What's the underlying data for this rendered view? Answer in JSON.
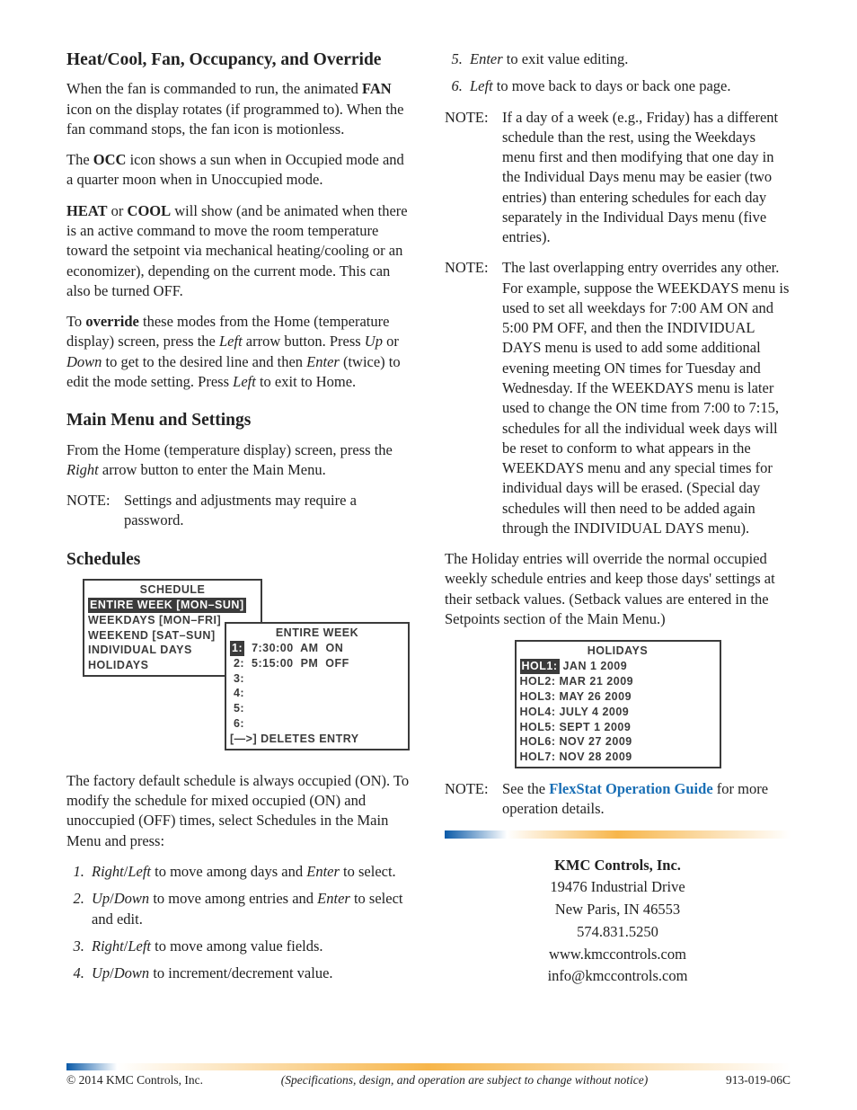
{
  "left": {
    "h_heatcool": "Heat/Cool, Fan, Occupancy, and Override",
    "p1a": "When the fan is commanded to run, the animated ",
    "p1b": "FAN",
    "p1c": " icon on the display rotates (if programmed to). When the fan command stops, the fan icon is motionless.",
    "p2a": "The ",
    "p2b": "OCC",
    "p2c": " icon shows a sun when in Occupied mode and a quarter moon when in Unoccupied mode.",
    "p3a": "HEAT",
    "p3b": " or ",
    "p3c": "COOL",
    "p3d": " will show (and be animated when there is an active command to move the room temperature toward the setpoint via mechanical heating/cooling or an economizer), depending on the current mode. This can also be turned OFF.",
    "p4a": "To ",
    "p4b": "override",
    "p4c": " these modes from the Home (temperature display) screen, press the ",
    "p4d": "Left",
    "p4e": " arrow button. Press ",
    "p4f": "Up",
    "p4g": " or ",
    "p4h": "Down",
    "p4i": " to get to the desired line and then ",
    "p4j": "Enter",
    "p4k": " (twice) to edit the mode setting. Press ",
    "p4l": "Left",
    "p4m": " to exit to Home.",
    "h_main": "Main Menu and Settings",
    "p5a": "From the Home (temperature display) screen, press the ",
    "p5b": "Right",
    "p5c": " arrow button to enter the Main Menu.",
    "note_label": "NOTE:",
    "note1": "Settings and adjustments may require a password.",
    "h_sched": "Schedules",
    "schedule_panel": {
      "title": "SCHEDULE",
      "sel": "ENTIRE WEEK [MON–SUN]",
      "rows": [
        "WEEKDAYS [MON–FRI]",
        "WEEKEND [SAT–SUN]",
        "INDIVIDUAL DAYS",
        "HOLIDAYS"
      ]
    },
    "entire_panel": {
      "title": "ENTIRE WEEK",
      "row1_sel": "1:",
      "row1_rest": "  7:30:00  AM  ON",
      "row2": " 2:  5:15:00  PM  OFF",
      "rows_rest": [
        " 3:",
        " 4:",
        " 5:",
        " 6:"
      ],
      "footer": "[—>] DELETES ENTRY"
    },
    "p6": "The factory default schedule is always occupied (ON). To modify the schedule for mixed occupied (ON) and unoccupied (OFF) times, select Schedules in the Main Menu and press:",
    "steps": [
      {
        "a": "Right",
        "b": "/",
        "c": "Left",
        "d": " to move among days and ",
        "e": "Enter",
        "f": " to select."
      },
      {
        "a": "Up",
        "b": "/",
        "c": "Down",
        "d": " to move among entries and ",
        "e": "Enter",
        "f": " to select and edit."
      },
      {
        "a": "Right",
        "b": "/",
        "c": "Left",
        "d": " to move among value fields."
      },
      {
        "a": "Up",
        "b": "/",
        "c": "Down",
        "d": " to increment/decrement value."
      }
    ]
  },
  "right": {
    "step5a": "Enter",
    "step5b": " to exit value editing.",
    "step6a": "Left",
    "step6b": " to move back to days or back one page.",
    "note_label": "NOTE:",
    "note1": "If a day of a week (e.g., Friday) has a different schedule than the rest, using the Weekdays menu first and then modifying that one day in the Individual Days menu may be easier (two entries) than entering schedules for each day separately in the Individual Days menu (five entries).",
    "note2": "The last overlapping entry overrides any other. For example, suppose the WEEKDAYS menu is used to set all weekdays for 7:00 AM ON and 5:00 PM OFF, and then the INDIVIDUAL DAYS menu is used to add some additional evening meeting ON times for Tuesday and Wednesday. If the WEEKDAYS menu is later used to change the ON time from 7:00 to 7:15, schedules for all the individual week days will be reset to conform to what appears in the WEEKDAYS menu and any special times for individual days will be erased. (Special day schedules will then need to be added again through the INDIVIDUAL DAYS menu).",
    "p_holiday": "The Holiday entries will override the normal occupied weekly schedule entries and keep those days' settings at their setback values. (Setback values are entered in the Setpoints section of the Main Menu.)",
    "holidays_panel": {
      "title": "HOLIDAYS",
      "sel_label": "HOL1:",
      "sel_rest": " JAN 1 2009",
      "rows": [
        "HOL2: MAR 21 2009",
        "HOL3: MAY 26 2009",
        "HOL4: JULY 4 2009",
        "HOL5: SEPT 1 2009",
        "HOL6: NOV 27 2009",
        "HOL7: NOV 28 2009"
      ]
    },
    "note3a": "See the ",
    "note3b": "FlexStat Operation Guide",
    "note3c": " for more operation details.",
    "contact": {
      "name": "KMC Controls, Inc.",
      "addr1": "19476 Industrial Drive",
      "addr2": "New Paris, IN 46553",
      "phone": "574.831.5250",
      "web": "www.kmccontrols.com",
      "email": "info@kmccontrols.com"
    }
  },
  "footer": {
    "left": "© 2014 KMC Controls, Inc.",
    "mid": "(Specifications, design, and operation are subject to change without notice)",
    "right": "913-019-06C"
  }
}
